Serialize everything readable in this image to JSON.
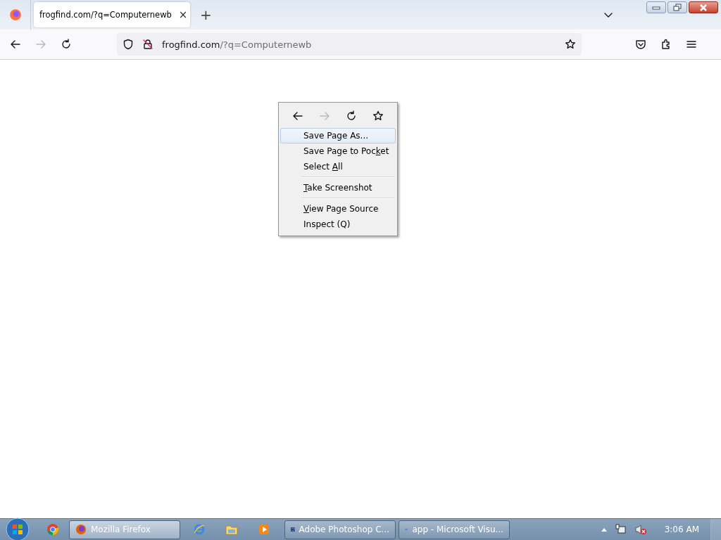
{
  "tabs": [
    {
      "title": "frogfind.com/?q=Computernewb",
      "selected": true,
      "close": "×"
    }
  ],
  "new_tab": "+",
  "address_bar": {
    "domain": "frogfind.com",
    "path": "/?q=Computernewb"
  },
  "nav": {
    "forward_disabled": true
  },
  "context_menu": {
    "nav": {
      "forward_disabled": true
    },
    "items": [
      {
        "kind": "item",
        "pre": "Save Page As...",
        "selected": true
      },
      {
        "kind": "item",
        "pre": "Save Page to Poc",
        "key": "k",
        "post": "et",
        "selected": false
      },
      {
        "kind": "item",
        "pre": "Select ",
        "key": "A",
        "post": "ll",
        "selected": false
      },
      {
        "kind": "separator"
      },
      {
        "kind": "item",
        "key": "T",
        "post": "ake Screenshot",
        "selected": false
      },
      {
        "kind": "separator"
      },
      {
        "kind": "item",
        "key": "V",
        "post": "iew Page Source",
        "selected": false
      },
      {
        "kind": "item",
        "pre": "Inspect (Q)",
        "selected": false
      }
    ]
  },
  "taskbar": {
    "buttons": [
      {
        "kind": "firefox",
        "label": "Mozilla Firefox",
        "selected": true
      },
      {
        "kind": "photoshop",
        "label": "Adobe Photoshop C...",
        "selected": false
      },
      {
        "kind": "vs",
        "label": "app - Microsoft Visu...",
        "selected": false
      }
    ],
    "clock": "3:06 AM"
  }
}
